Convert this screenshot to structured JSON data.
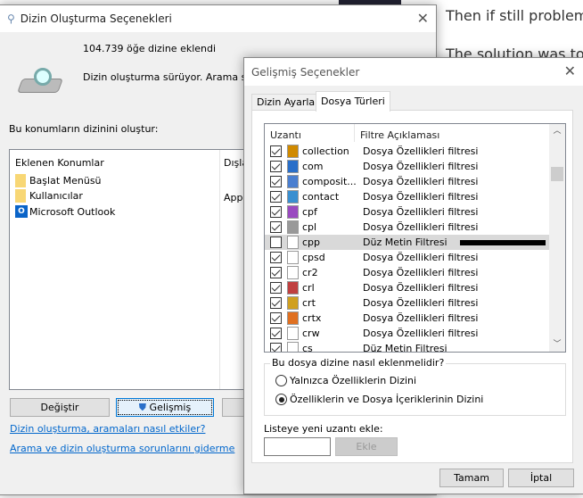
{
  "background": {
    "line1": "Then if still problems",
    "line2": "The solution was to"
  },
  "main_window": {
    "title": "Dizin Oluşturma Seçenekleri",
    "items_indexed": "104.739 öğe dizine eklendi",
    "status": "Dizin oluşturma sürüyor. Arama sonuç",
    "locations_label": "Bu konumların dizinini oluştur:",
    "columns": [
      "Eklenen Konumlar",
      "Dışla"
    ],
    "locations": [
      {
        "name": "Başlat Menüsü",
        "excluded": ""
      },
      {
        "name": "Kullanıcılar",
        "excluded": "AppD"
      },
      {
        "name": "Microsoft Outlook",
        "excluded": ""
      }
    ],
    "buttons": {
      "modify": "Değiştir",
      "advanced": "Gelişmiş"
    },
    "links": [
      "Dizin oluşturma, aramaları nasıl etkiler?",
      "Arama ve dizin oluşturma sorunlarını giderme"
    ]
  },
  "advanced_dialog": {
    "title": "Gelişmiş Seçenekler",
    "tabs": [
      {
        "label": "Dizin Ayarları",
        "active": false
      },
      {
        "label": "Dosya Türleri",
        "active": true
      }
    ],
    "columns": [
      "Uzantı",
      "Filtre Açıklaması"
    ],
    "file_types": [
      {
        "ext": "collection",
        "filter": "Dosya Özellikleri filtresi",
        "checked": true,
        "icon": "bridge-icon",
        "color": "#d08a00"
      },
      {
        "ext": "com",
        "filter": "Dosya Özellikleri filtresi",
        "checked": true,
        "icon": "app-icon",
        "color": "#2a6fc9"
      },
      {
        "ext": "composit...",
        "filter": "Dosya Özellikleri filtresi",
        "checked": true,
        "icon": "eye-icon",
        "color": "#4a7fd0"
      },
      {
        "ext": "contact",
        "filter": "Dosya Özellikleri filtresi",
        "checked": true,
        "icon": "contact-card-icon",
        "color": "#3a8fd0"
      },
      {
        "ext": "cpf",
        "filter": "Dosya Özellikleri filtresi",
        "checked": true,
        "icon": "cpf-file-icon",
        "color": "#9a4ac0"
      },
      {
        "ext": "cpl",
        "filter": "Dosya Özellikleri filtresi",
        "checked": true,
        "icon": "control-panel-icon",
        "color": "#999999"
      },
      {
        "ext": "cpp",
        "filter": "Düz Metin Filtresi",
        "checked": false,
        "selected": true,
        "icon": "file-icon",
        "color": "#ffffff"
      },
      {
        "ext": "cpsd",
        "filter": "Dosya Özellikleri filtresi",
        "checked": true,
        "icon": "file-icon",
        "color": "#ffffff"
      },
      {
        "ext": "cr2",
        "filter": "Dosya Özellikleri filtresi",
        "checked": true,
        "icon": "file-icon",
        "color": "#ffffff"
      },
      {
        "ext": "crl",
        "filter": "Dosya Özellikleri filtresi",
        "checked": true,
        "icon": "certificate-list-icon",
        "color": "#c04040"
      },
      {
        "ext": "crt",
        "filter": "Dosya Özellikleri filtresi",
        "checked": true,
        "icon": "certificate-icon",
        "color": "#d0a020"
      },
      {
        "ext": "crtx",
        "filter": "Dosya Özellikleri filtresi",
        "checked": true,
        "icon": "chart-file-icon",
        "color": "#e07020"
      },
      {
        "ext": "crw",
        "filter": "Dosya Özellikleri filtresi",
        "checked": true,
        "icon": "file-icon",
        "color": "#ffffff"
      },
      {
        "ext": "cs",
        "filter": "Düz Metin Filtresi",
        "checked": true,
        "icon": "file-icon",
        "color": "#ffffff"
      }
    ],
    "group_label": "Bu dosya dizine nasıl eklenmelidir?",
    "options": [
      {
        "label": "Yalnızca Özelliklerin Dizini",
        "selected": false
      },
      {
        "label": "Özelliklerin ve Dosya İçeriklerinin Dizini",
        "selected": true
      }
    ],
    "add_label": "Listeye yeni uzantı ekle:",
    "add_value": "",
    "add_button": "Ekle",
    "ok": "Tamam",
    "cancel": "İptal"
  }
}
